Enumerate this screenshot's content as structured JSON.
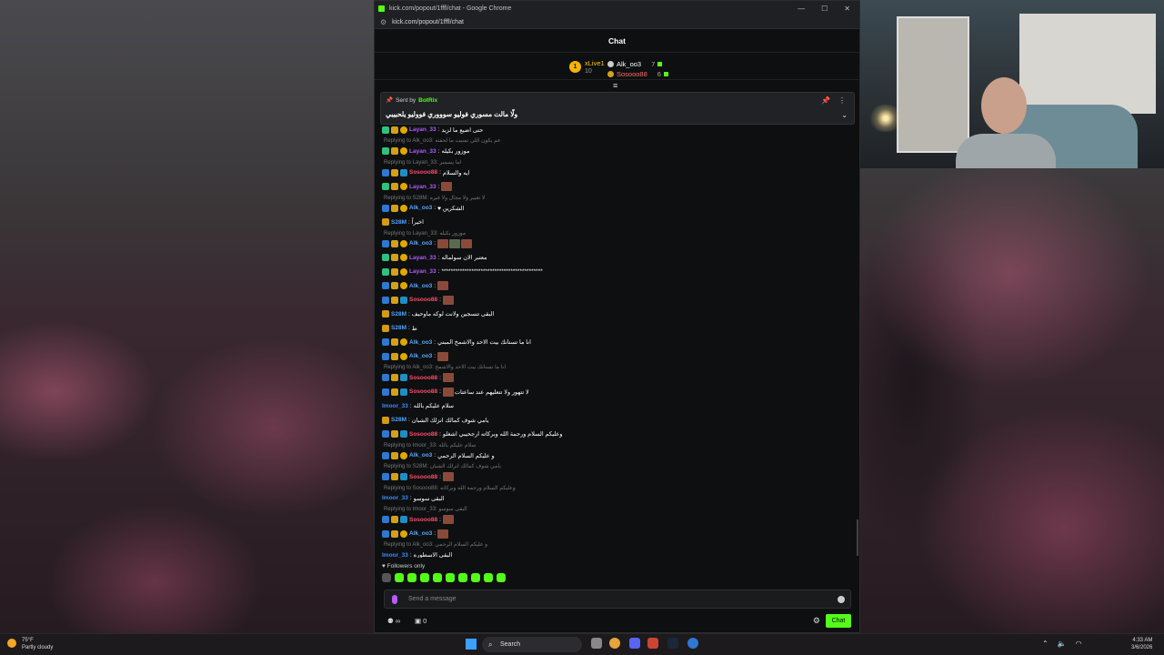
{
  "browser": {
    "title": "kick.com/popout/1fffl/chat - Google Chrome",
    "url": "kick.com/popout/1fffl/chat"
  },
  "chat": {
    "heading": "Chat",
    "leaderboard": [
      {
        "rank": "1",
        "name": "xLive1",
        "count": "10"
      },
      {
        "name": "Alk_oo3",
        "count": "7"
      },
      {
        "name": "Sosooo88",
        "count": "6"
      }
    ],
    "pinned": {
      "sent_by": "Sent by",
      "sender": "BotRix",
      "message": "ولّا مالت مسوري فوليو سوووري فووليو يلحبيبي"
    },
    "messages": [
      {
        "name": "Layan_33",
        "color": "lay",
        "badges": [
          "sub",
          "cup",
          "vip"
        ],
        "text": "حتى اضيع ما لزيد"
      },
      {
        "reply": "Replying to Alk_oo3: عم يكون اللي تمنيت ما لحقته"
      },
      {
        "name": "Layan_33",
        "color": "lay",
        "badges": [
          "sub",
          "cup",
          "vip"
        ],
        "text": "موزور بكيله"
      },
      {
        "reply": "Replying to Layan_33: اما يسمبر"
      },
      {
        "name": "Sosooo88",
        "color": "sos",
        "badges": [
          "sword",
          "cup",
          "gift"
        ],
        "text": "ايه والسلام"
      },
      {
        "name": "Layan_33",
        "color": "lay",
        "badges": [
          "sub",
          "cup",
          "vip"
        ],
        "emotes": 1
      },
      {
        "reply": "Replying to S28M: لا تغيير ولا مجال ولا غيره"
      },
      {
        "name": "Alk_oo3",
        "color": "alk",
        "badges": [
          "sword",
          "cup",
          "vip"
        ],
        "text": "الشكرين ♥"
      },
      {
        "name": "S28M",
        "color": "s28",
        "badges": [
          "crown"
        ],
        "text": "اخيراً"
      },
      {
        "reply": "Replying to Layan_33: موزور بكيله"
      },
      {
        "name": "Alk_oo3",
        "color": "alk",
        "badges": [
          "sword",
          "cup",
          "vip"
        ],
        "emotes": 3
      },
      {
        "name": "Layan_33",
        "color": "lay",
        "badges": [
          "sub",
          "cup",
          "vip"
        ],
        "text": "معتبر الان سولماله"
      },
      {
        "name": "Layan_33",
        "color": "lay",
        "badges": [
          "sub",
          "cup",
          "vip"
        ],
        "text": "********************************************"
      },
      {
        "name": "Alk_oo3",
        "color": "alk",
        "badges": [
          "sword",
          "cup",
          "vip"
        ],
        "emotes": 1
      },
      {
        "name": "Sosooo88",
        "color": "sos",
        "badges": [
          "sword",
          "cup",
          "gift"
        ],
        "emotes": 1
      },
      {
        "name": "S28M",
        "color": "s28",
        "badges": [
          "crown"
        ],
        "text": "البقى تنسجين ولانت لوكه ماوحيف"
      },
      {
        "name": "S28M",
        "color": "s28",
        "badges": [
          "crown"
        ],
        "text": "ط"
      },
      {
        "name": "Alk_oo3",
        "color": "alk",
        "badges": [
          "sword",
          "cup",
          "vip"
        ],
        "text": "انا ما تسنانك بيت الاحد والاشمخ المبني"
      },
      {
        "name": "Alk_oo3",
        "color": "alk",
        "badges": [
          "sword",
          "cup",
          "vip"
        ],
        "emotes": 1
      },
      {
        "reply": "Replying to Alk_oo3: انا ما تسنانك بيت الاحد والاشمخ"
      },
      {
        "name": "Sosooo88",
        "color": "sos",
        "badges": [
          "sword",
          "cup",
          "gift"
        ],
        "emotes": 1
      },
      {
        "name": "Sosooo88",
        "color": "sos",
        "badges": [
          "sword",
          "cup",
          "gift"
        ],
        "text": "لا تتهور ولا تتعليهم عند ساعتات",
        "emotes": 1
      },
      {
        "name": "Imoor_33",
        "color": "imo",
        "badges": [],
        "text": "سلام عليكم بالله"
      },
      {
        "name": "S28M",
        "color": "s28",
        "badges": [
          "crown"
        ],
        "text": "يامي شوف كمالك انزلك الشبان"
      },
      {
        "name": "Sosooo88",
        "color": "sos",
        "badges": [
          "sword",
          "cup",
          "gift"
        ],
        "text": "وعليكم السلام ورحمة الله وبركاته ارجحيبي اشغلو"
      },
      {
        "reply": "Replying to Imoor_33: سلام عليكم بالله"
      },
      {
        "name": "Alk_oo3",
        "color": "alk",
        "badges": [
          "sword",
          "cup",
          "vip"
        ],
        "text": "و عليكم السلام الرحمي"
      },
      {
        "reply": "Replying to S28M: يامي شوف كمالك انزلك الشبان"
      },
      {
        "name": "Sosooo88",
        "color": "sos",
        "badges": [
          "sword",
          "cup",
          "gift"
        ],
        "emotes": 1
      },
      {
        "reply": "Replying to Sosooo88: وعليكم السلام ورحمة الله وبركاته"
      },
      {
        "name": "Imoor_33",
        "color": "imo",
        "badges": [],
        "text": "البقى سوسو"
      },
      {
        "reply": "Replying to Imoor_33: البقى سوسو"
      },
      {
        "name": "Sosooo88",
        "color": "sos",
        "badges": [
          "sword",
          "cup",
          "gift"
        ],
        "emotes": 1
      },
      {
        "name": "Alk_oo3",
        "color": "alk",
        "badges": [
          "sword",
          "cup",
          "vip"
        ],
        "emotes": 1
      },
      {
        "reply": "Replying to Alk_oo3: و عليكم السلام الرحمي"
      },
      {
        "name": "Imoor_33",
        "color": "imo",
        "badges": [],
        "text": "البقى الاسطوره"
      }
    ],
    "followers_only": "Followers only",
    "input_placeholder": "Send a message",
    "points": "∞",
    "tickets": "0",
    "send_label": "Chat"
  },
  "taskbar": {
    "temp": "75°F",
    "weather": "Partly cloudy",
    "search": "Search",
    "time": "4:33 AM",
    "date": "3/6/2026"
  }
}
